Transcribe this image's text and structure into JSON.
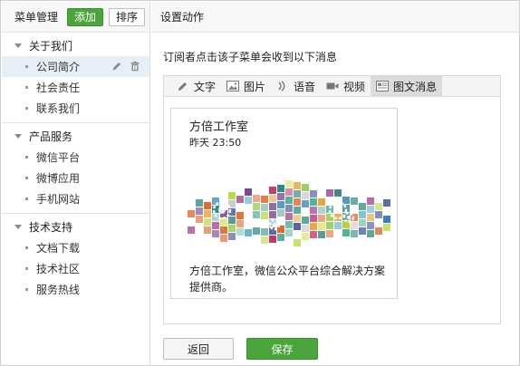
{
  "left_panel": {
    "title": "菜单管理",
    "add_label": "添加",
    "sort_label": "排序",
    "groups": [
      {
        "title": "关于我们",
        "items": [
          "公司简介",
          "社会责任",
          "联系我们"
        ]
      },
      {
        "title": "产品服务",
        "items": [
          "微信平台",
          "微博应用",
          "手机网站"
        ]
      },
      {
        "title": "技术支持",
        "items": [
          "文档下载",
          "技术社区",
          "服务热线"
        ]
      }
    ],
    "active_item": "公司简介"
  },
  "right_panel": {
    "title": "设置动作",
    "hint": "订阅者点击该子菜单会收到以下消息",
    "tabs": [
      {
        "label": "文字",
        "icon": "pencil-icon"
      },
      {
        "label": "图片",
        "icon": "image-icon"
      },
      {
        "label": "语音",
        "icon": "audio-icon"
      },
      {
        "label": "视频",
        "icon": "video-icon"
      },
      {
        "label": "图文消息",
        "icon": "news-icon",
        "active": true
      }
    ],
    "message": {
      "title": "方倍工作室",
      "time": "昨天 23:50",
      "description": "方倍工作室，微信公众平台综合解决方案提供商。"
    },
    "back_label": "返回",
    "save_label": "保存"
  },
  "colors": {
    "green": "#4aa53a",
    "active_bg": "#e6eef8",
    "border": "#d6d6d6"
  }
}
